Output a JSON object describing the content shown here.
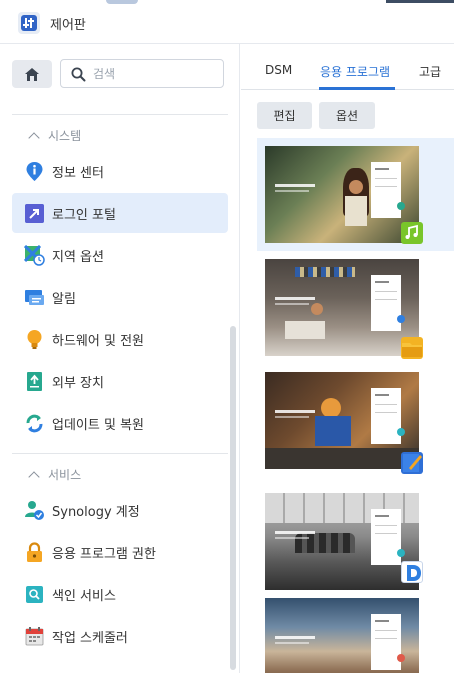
{
  "window": {
    "title": "제어판"
  },
  "search": {
    "placeholder": "검색"
  },
  "sidebar": {
    "sections": [
      {
        "label": "시스템",
        "items": [
          {
            "label": "정보 센터",
            "icon": "info-icon",
            "active": false
          },
          {
            "label": "로그인 포털",
            "icon": "login-portal-icon",
            "active": true
          },
          {
            "label": "지역 옵션",
            "icon": "regional-options-icon",
            "active": false
          },
          {
            "label": "알림",
            "icon": "notification-icon",
            "active": false
          },
          {
            "label": "하드웨어 및 전원",
            "icon": "hardware-power-icon",
            "active": false
          },
          {
            "label": "외부 장치",
            "icon": "external-devices-icon",
            "active": false
          },
          {
            "label": "업데이트 및 복원",
            "icon": "update-restore-icon",
            "active": false
          }
        ]
      },
      {
        "label": "서비스",
        "items": [
          {
            "label": "Synology 계정",
            "icon": "synology-account-icon",
            "active": false
          },
          {
            "label": "응용 프로그램 권한",
            "icon": "application-privileges-icon",
            "active": false
          },
          {
            "label": "색인 서비스",
            "icon": "indexing-service-icon",
            "active": false
          },
          {
            "label": "작업 스케줄러",
            "icon": "task-scheduler-icon",
            "active": false
          }
        ]
      }
    ]
  },
  "tabs": [
    {
      "label": "DSM",
      "active": false
    },
    {
      "label": "응용 프로그램",
      "active": true
    },
    {
      "label": "고급",
      "active": false
    }
  ],
  "toolbar": {
    "edit_label": "편집",
    "options_label": "옵션"
  },
  "apps": [
    {
      "name": "audio-station",
      "icon": "audio-station-icon",
      "selected": true
    },
    {
      "name": "file-station",
      "icon": "file-station-icon",
      "selected": false
    },
    {
      "name": "note-station",
      "icon": "note-station-icon",
      "selected": false
    },
    {
      "name": "drive",
      "icon": "drive-icon",
      "selected": false
    },
    {
      "name": "photos",
      "icon": "photos-icon",
      "selected": false
    }
  ],
  "colors": {
    "accent": "#2a72d5",
    "active_bg": "#e3edfb",
    "selected_row": "#e8f1fc"
  }
}
